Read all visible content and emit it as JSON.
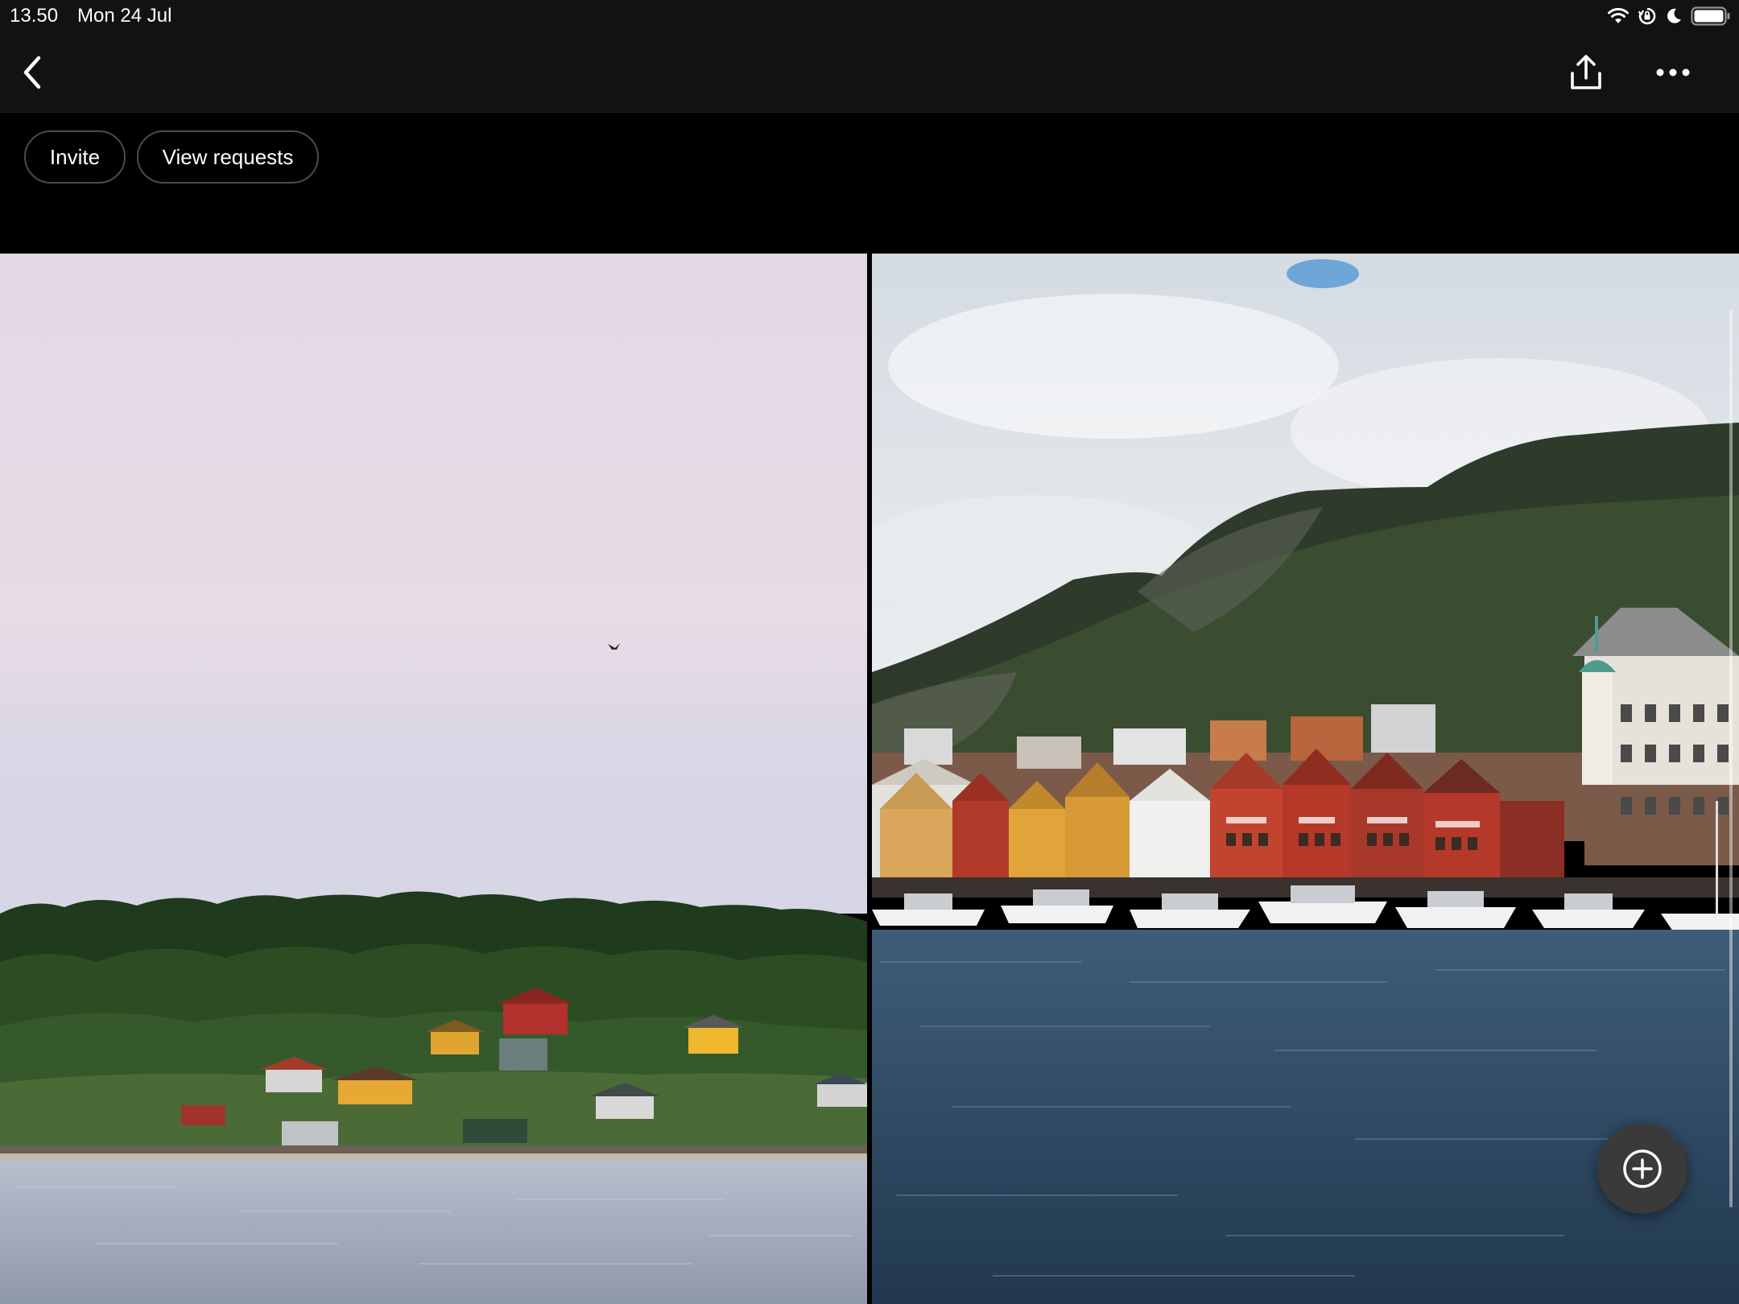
{
  "status_bar": {
    "time": "13.50",
    "date": "Mon 24 Jul",
    "icons": [
      "wifi-icon",
      "orientation-lock-icon",
      "do-not-disturb-icon",
      "battery-icon"
    ]
  },
  "nav_bar": {
    "back_icon": "chevron-left-icon",
    "share_icon": "share-icon",
    "more_icon": "ellipsis-icon"
  },
  "actions": {
    "invite_label": "Invite",
    "view_requests_label": "View requests"
  },
  "photos": [
    {
      "subject": "Pastel sky over forested island shoreline with colourful cottages"
    },
    {
      "subject": "Colourful wooden harbour houses below a green mountain with boats on the water"
    }
  ],
  "fab": {
    "icon": "plus-circle-icon"
  },
  "colors": {
    "bar_background": "#121212",
    "page_background": "#000000",
    "pill_border": "#4a4a4a",
    "fab_background": "#3a3a3a"
  }
}
